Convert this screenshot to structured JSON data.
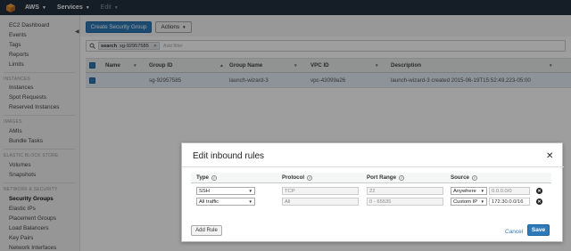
{
  "topbar": {
    "brand": "AWS",
    "services": "Services",
    "edit": "Edit"
  },
  "sidebar": {
    "items": [
      {
        "label": "EC2 Dashboard"
      },
      {
        "label": "Events"
      },
      {
        "label": "Tags"
      },
      {
        "label": "Reports"
      },
      {
        "label": "Limits"
      }
    ],
    "instances_section": "INSTANCES",
    "instances": [
      "Instances",
      "Spot Requests",
      "Reserved Instances"
    ],
    "images_section": "IMAGES",
    "images": [
      "AMIs",
      "Bundle Tasks"
    ],
    "ebs_section": "ELASTIC BLOCK STORE",
    "ebs": [
      "Volumes",
      "Snapshots"
    ],
    "network_section": "NETWORK & SECURITY",
    "network": [
      "Security Groups",
      "Elastic IPs",
      "Placement Groups",
      "Load Balancers",
      "Key Pairs",
      "Network Interfaces"
    ]
  },
  "toolbar": {
    "create_label": "Create Security Group",
    "actions_label": "Actions"
  },
  "filter": {
    "token_key": "search",
    "token_value": "sg-92957585",
    "placeholder": "Add filter"
  },
  "table": {
    "headers": [
      "Name",
      "Group ID",
      "Group Name",
      "VPC ID",
      "Description"
    ],
    "rows": [
      {
        "name": "",
        "group_id": "sg-92957585",
        "group_name": "launch-wizard-3",
        "vpc_id": "vpc-43099a26",
        "description": "launch-wizard-3 created 2015-06-19T15:52:49.223-05:00"
      }
    ]
  },
  "modal": {
    "title": "Edit inbound rules",
    "headers": {
      "type": "Type",
      "protocol": "Protocol",
      "port_range": "Port Range",
      "source": "Source"
    },
    "rules": [
      {
        "type": "SSH",
        "protocol": "TCP",
        "port_range": "22",
        "source_type": "Anywhere",
        "source_value": "0.0.0.0/0"
      },
      {
        "type": "All traffic",
        "protocol": "All",
        "port_range": "0 - 65535",
        "source_type": "Custom IP",
        "source_value": "172.30.0.0/16"
      }
    ],
    "add_rule_label": "Add Rule",
    "cancel_label": "Cancel",
    "save_label": "Save"
  }
}
